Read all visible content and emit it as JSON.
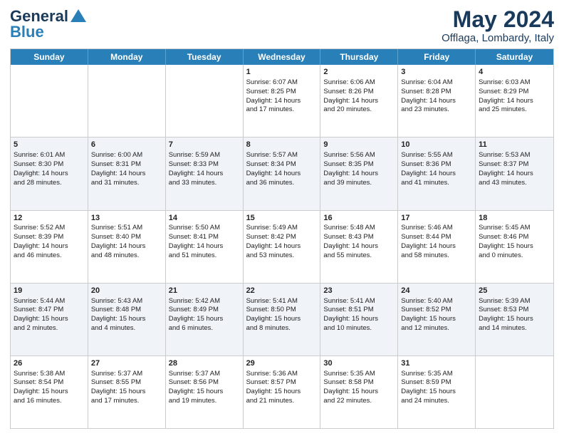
{
  "header": {
    "logo_general": "General",
    "logo_blue": "Blue",
    "month_title": "May 2024",
    "subtitle": "Offlaga, Lombardy, Italy"
  },
  "days_of_week": [
    "Sunday",
    "Monday",
    "Tuesday",
    "Wednesday",
    "Thursday",
    "Friday",
    "Saturday"
  ],
  "rows": [
    {
      "alt": false,
      "cells": [
        {
          "day": "",
          "info": ""
        },
        {
          "day": "",
          "info": ""
        },
        {
          "day": "",
          "info": ""
        },
        {
          "day": "1",
          "info": "Sunrise: 6:07 AM\nSunset: 8:25 PM\nDaylight: 14 hours\nand 17 minutes."
        },
        {
          "day": "2",
          "info": "Sunrise: 6:06 AM\nSunset: 8:26 PM\nDaylight: 14 hours\nand 20 minutes."
        },
        {
          "day": "3",
          "info": "Sunrise: 6:04 AM\nSunset: 8:28 PM\nDaylight: 14 hours\nand 23 minutes."
        },
        {
          "day": "4",
          "info": "Sunrise: 6:03 AM\nSunset: 8:29 PM\nDaylight: 14 hours\nand 25 minutes."
        }
      ]
    },
    {
      "alt": true,
      "cells": [
        {
          "day": "5",
          "info": "Sunrise: 6:01 AM\nSunset: 8:30 PM\nDaylight: 14 hours\nand 28 minutes."
        },
        {
          "day": "6",
          "info": "Sunrise: 6:00 AM\nSunset: 8:31 PM\nDaylight: 14 hours\nand 31 minutes."
        },
        {
          "day": "7",
          "info": "Sunrise: 5:59 AM\nSunset: 8:33 PM\nDaylight: 14 hours\nand 33 minutes."
        },
        {
          "day": "8",
          "info": "Sunrise: 5:57 AM\nSunset: 8:34 PM\nDaylight: 14 hours\nand 36 minutes."
        },
        {
          "day": "9",
          "info": "Sunrise: 5:56 AM\nSunset: 8:35 PM\nDaylight: 14 hours\nand 39 minutes."
        },
        {
          "day": "10",
          "info": "Sunrise: 5:55 AM\nSunset: 8:36 PM\nDaylight: 14 hours\nand 41 minutes."
        },
        {
          "day": "11",
          "info": "Sunrise: 5:53 AM\nSunset: 8:37 PM\nDaylight: 14 hours\nand 43 minutes."
        }
      ]
    },
    {
      "alt": false,
      "cells": [
        {
          "day": "12",
          "info": "Sunrise: 5:52 AM\nSunset: 8:39 PM\nDaylight: 14 hours\nand 46 minutes."
        },
        {
          "day": "13",
          "info": "Sunrise: 5:51 AM\nSunset: 8:40 PM\nDaylight: 14 hours\nand 48 minutes."
        },
        {
          "day": "14",
          "info": "Sunrise: 5:50 AM\nSunset: 8:41 PM\nDaylight: 14 hours\nand 51 minutes."
        },
        {
          "day": "15",
          "info": "Sunrise: 5:49 AM\nSunset: 8:42 PM\nDaylight: 14 hours\nand 53 minutes."
        },
        {
          "day": "16",
          "info": "Sunrise: 5:48 AM\nSunset: 8:43 PM\nDaylight: 14 hours\nand 55 minutes."
        },
        {
          "day": "17",
          "info": "Sunrise: 5:46 AM\nSunset: 8:44 PM\nDaylight: 14 hours\nand 58 minutes."
        },
        {
          "day": "18",
          "info": "Sunrise: 5:45 AM\nSunset: 8:46 PM\nDaylight: 15 hours\nand 0 minutes."
        }
      ]
    },
    {
      "alt": true,
      "cells": [
        {
          "day": "19",
          "info": "Sunrise: 5:44 AM\nSunset: 8:47 PM\nDaylight: 15 hours\nand 2 minutes."
        },
        {
          "day": "20",
          "info": "Sunrise: 5:43 AM\nSunset: 8:48 PM\nDaylight: 15 hours\nand 4 minutes."
        },
        {
          "day": "21",
          "info": "Sunrise: 5:42 AM\nSunset: 8:49 PM\nDaylight: 15 hours\nand 6 minutes."
        },
        {
          "day": "22",
          "info": "Sunrise: 5:41 AM\nSunset: 8:50 PM\nDaylight: 15 hours\nand 8 minutes."
        },
        {
          "day": "23",
          "info": "Sunrise: 5:41 AM\nSunset: 8:51 PM\nDaylight: 15 hours\nand 10 minutes."
        },
        {
          "day": "24",
          "info": "Sunrise: 5:40 AM\nSunset: 8:52 PM\nDaylight: 15 hours\nand 12 minutes."
        },
        {
          "day": "25",
          "info": "Sunrise: 5:39 AM\nSunset: 8:53 PM\nDaylight: 15 hours\nand 14 minutes."
        }
      ]
    },
    {
      "alt": false,
      "cells": [
        {
          "day": "26",
          "info": "Sunrise: 5:38 AM\nSunset: 8:54 PM\nDaylight: 15 hours\nand 16 minutes."
        },
        {
          "day": "27",
          "info": "Sunrise: 5:37 AM\nSunset: 8:55 PM\nDaylight: 15 hours\nand 17 minutes."
        },
        {
          "day": "28",
          "info": "Sunrise: 5:37 AM\nSunset: 8:56 PM\nDaylight: 15 hours\nand 19 minutes."
        },
        {
          "day": "29",
          "info": "Sunrise: 5:36 AM\nSunset: 8:57 PM\nDaylight: 15 hours\nand 21 minutes."
        },
        {
          "day": "30",
          "info": "Sunrise: 5:35 AM\nSunset: 8:58 PM\nDaylight: 15 hours\nand 22 minutes."
        },
        {
          "day": "31",
          "info": "Sunrise: 5:35 AM\nSunset: 8:59 PM\nDaylight: 15 hours\nand 24 minutes."
        },
        {
          "day": "",
          "info": ""
        }
      ]
    }
  ]
}
